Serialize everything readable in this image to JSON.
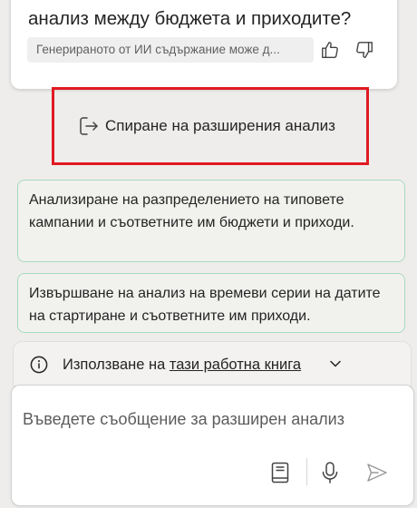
{
  "answer_card": {
    "question_text": "анализ между бюджета и приходите?",
    "ai_disclaimer": "Генерираното от ИИ съдържание може д..."
  },
  "stop_action": {
    "label": "Спиране на разширения анализ"
  },
  "suggestions": [
    {
      "text": "Анализиране на разпределението на типовете кампании и съответните им бюджети и приходи."
    },
    {
      "text": "Извършване на анализ на времеви серии на датите на стартиране и съответните им приходи."
    }
  ],
  "context_bar": {
    "prefix": "Използване на",
    "link": "тази работна книга"
  },
  "composer": {
    "placeholder": "Въведете съобщение за разширен анализ"
  },
  "icons": {
    "thumb_up": "thumb-up-icon",
    "thumb_down": "thumb-down-icon",
    "stop": "exit-arrow-icon",
    "info": "info-icon",
    "chevron": "chevron-down-icon",
    "book": "notebook-icon",
    "mic": "microphone-icon",
    "send": "send-icon"
  },
  "colors": {
    "highlight": "#e01a22",
    "suggestion_border": "#a9d8c4",
    "background": "#eeedeb"
  }
}
